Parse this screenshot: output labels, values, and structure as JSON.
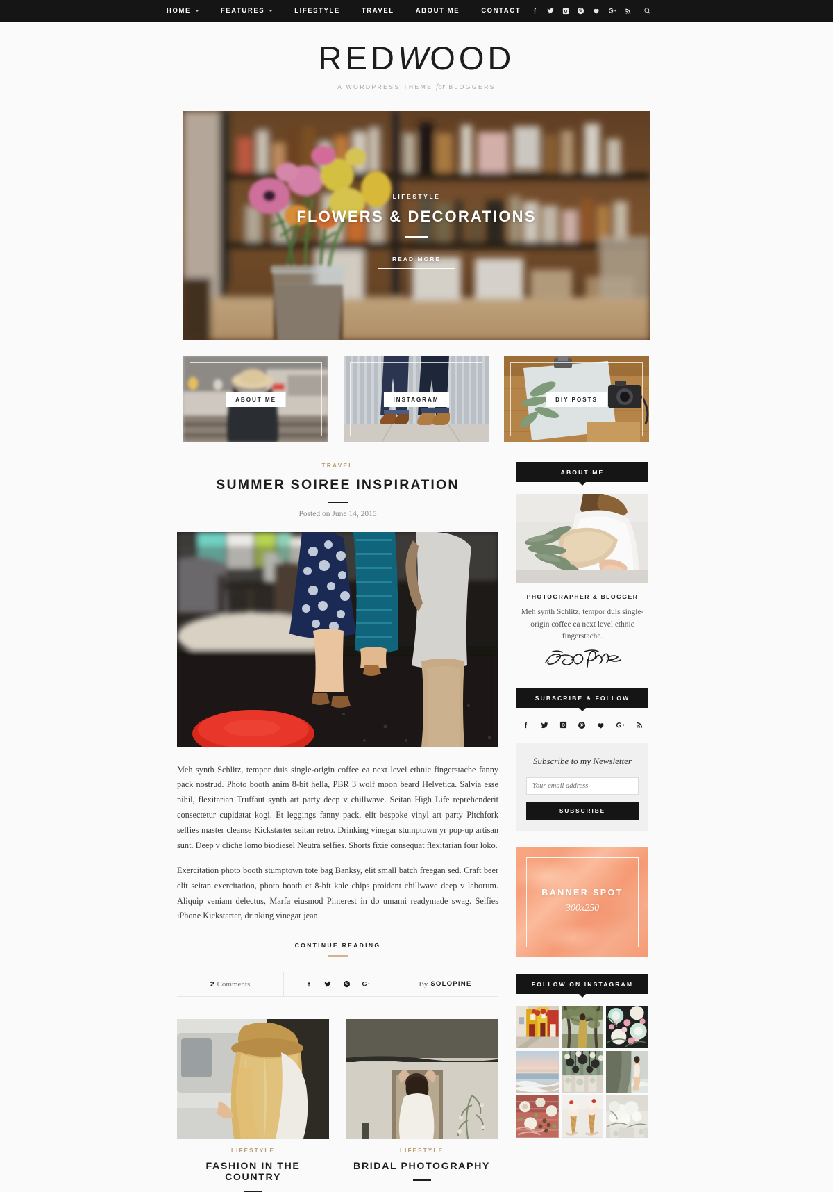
{
  "nav": {
    "items": [
      {
        "label": "HOME",
        "has_dropdown": true
      },
      {
        "label": "FEATURES",
        "has_dropdown": true
      },
      {
        "label": "LIFESTYLE",
        "has_dropdown": false
      },
      {
        "label": "TRAVEL",
        "has_dropdown": false
      },
      {
        "label": "ABOUT ME",
        "has_dropdown": false
      },
      {
        "label": "CONTACT",
        "has_dropdown": false
      }
    ],
    "social": [
      "facebook-icon",
      "twitter-icon",
      "instagram-icon",
      "pinterest-icon",
      "bloglovin-heart-icon",
      "google-plus-icon",
      "rss-icon"
    ],
    "search_icon": "search-icon"
  },
  "branding": {
    "name_part1": "RED",
    "name_part2": "W",
    "name_part3": "OOD",
    "tagline_a": "A WORDPRESS THEME",
    "tagline_for": "for",
    "tagline_b": "BLOGGERS"
  },
  "hero": {
    "category": "LIFESTYLE",
    "title": "FLOWERS & DECORATIONS",
    "button": "READ MORE"
  },
  "promos": [
    {
      "label": "ABOUT ME"
    },
    {
      "label": "INSTAGRAM"
    },
    {
      "label": "DIY POSTS"
    }
  ],
  "post": {
    "category": "TRAVEL",
    "title": "SUMMER SOIREE INSPIRATION",
    "date": "Posted on June 14, 2015",
    "paragraph1": "Meh synth Schlitz, tempor duis single-origin coffee ea next level ethnic fingerstache fanny pack nostrud. Photo booth anim 8-bit hella, PBR 3 wolf moon beard Helvetica. Salvia esse nihil, flexitarian Truffaut synth art party deep v chillwave. Seitan High Life reprehenderit consectetur cupidatat kogi. Et leggings fanny pack, elit bespoke vinyl art party Pitchfork selfies master cleanse Kickstarter seitan retro. Drinking vinegar stumptown yr pop-up artisan sunt. Deep v cliche lomo biodiesel Neutra selfies. Shorts fixie consequat flexitarian four loko.",
    "paragraph2": "Exercitation photo booth stumptown tote bag Banksy, elit small batch freegan sed. Craft beer elit seitan exercitation, photo booth et 8-bit kale chips proident chillwave deep v laborum. Aliquip veniam delectus, Marfa eiusmod Pinterest in do umami readymade swag. Selfies iPhone Kickstarter, drinking vinegar jean.",
    "continue_label": "CONTINUE READING",
    "comments_count": "2",
    "comments_word": "Comments",
    "share_icons": [
      "facebook-icon",
      "twitter-icon",
      "pinterest-icon",
      "google-plus-icon"
    ],
    "by_prefix": "By",
    "author": "SOLOPINE"
  },
  "grid_posts": [
    {
      "category": "LIFESTYLE",
      "title": "FASHION IN THE COUNTRY"
    },
    {
      "category": "LIFESTYLE",
      "title": "BRIDAL PHOTOGRAPHY"
    }
  ],
  "sidebar": {
    "about": {
      "title": "ABOUT ME",
      "role": "PHOTOGRAPHER & BLOGGER",
      "text": "Meh synth Schlitz, tempor duis single-origin coffee ea next level ethnic fingerstache.",
      "signature": "Solo Pine"
    },
    "subscribe": {
      "title": "SUBSCRIBE & FOLLOW",
      "social": [
        "facebook-icon",
        "twitter-icon",
        "instagram-icon",
        "pinterest-icon",
        "bloglovin-heart-icon",
        "google-plus-icon",
        "rss-icon"
      ],
      "newsletter_title": "Subscribe to my Newsletter",
      "email_placeholder": "Your email address",
      "button": "SUBSCRIBE"
    },
    "banner": {
      "label": "BANNER SPOT",
      "size": "300x250"
    },
    "instagram": {
      "title": "FOLLOW ON INSTAGRAM",
      "cells": [
        {
          "name": "colorful-street-houses"
        },
        {
          "name": "woman-under-tree"
        },
        {
          "name": "floral-plates-flatlay"
        },
        {
          "name": "beach-sunset"
        },
        {
          "name": "hanging-planters"
        },
        {
          "name": "woman-on-beach"
        },
        {
          "name": "picnic-spread"
        },
        {
          "name": "ice-cream-cones"
        },
        {
          "name": "white-floral-table"
        }
      ]
    }
  },
  "colors": {
    "accent": "#b99b74",
    "dark": "#151515",
    "background": "#fafafa",
    "banner": "#f7a17b"
  }
}
